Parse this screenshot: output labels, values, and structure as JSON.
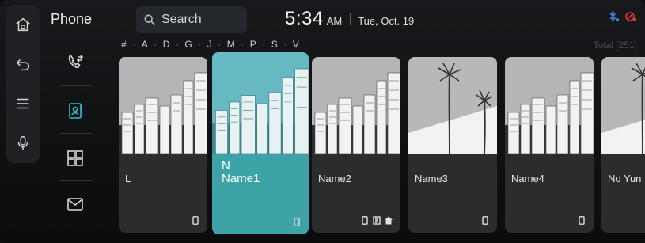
{
  "app": {
    "title": "Phone"
  },
  "search": {
    "label": "Search"
  },
  "clock": {
    "time": "5:34",
    "ampm": "AM",
    "date": "Tue, Oct. 19"
  },
  "index": [
    "#",
    "A",
    "D",
    "G",
    "J",
    "M",
    "P",
    "S",
    "V"
  ],
  "total": "Total [251]",
  "rail": [
    {
      "name": "home-icon"
    },
    {
      "name": "back-icon"
    },
    {
      "name": "menu-icon"
    },
    {
      "name": "microphone-icon"
    }
  ],
  "sidebar": [
    {
      "name": "call-history-icon",
      "active": false
    },
    {
      "name": "contacts-icon",
      "active": true
    },
    {
      "name": "keypad-icon",
      "active": false
    },
    {
      "name": "message-icon",
      "active": false
    }
  ],
  "contacts": [
    {
      "label": "L",
      "icons": [
        "mobile"
      ]
    },
    {
      "label": "N\nName1",
      "icons": [
        "mobile"
      ],
      "active": true
    },
    {
      "label": "Name2",
      "icons": [
        "mobile",
        "office",
        "home"
      ]
    },
    {
      "label": "Name3",
      "icons": [
        "mobile"
      ]
    },
    {
      "label": "Name4",
      "icons": [
        "mobile"
      ]
    },
    {
      "label": "No Yun",
      "icons": []
    }
  ],
  "colors": {
    "accent": "#2ec0c6",
    "card": "#2b2c2e",
    "active_card": "#3ea3a6"
  }
}
